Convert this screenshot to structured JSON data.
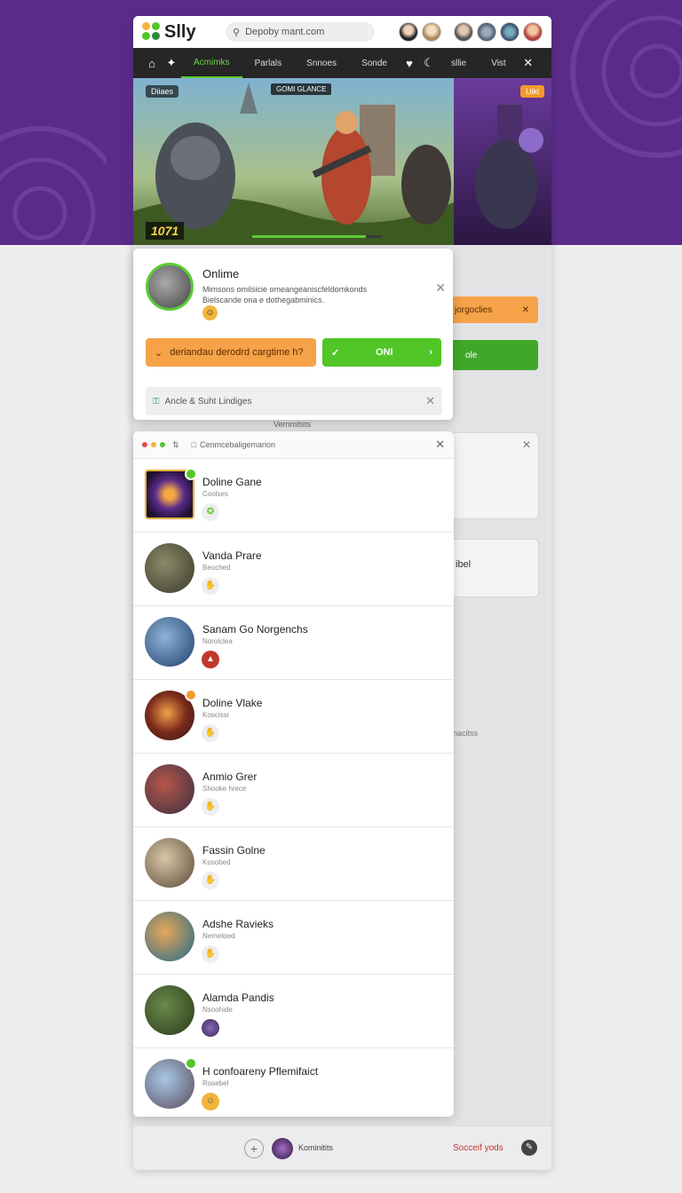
{
  "app": {
    "name": "Slly"
  },
  "search": {
    "placeholder": "Depoby mant.com"
  },
  "nav": {
    "tabs": [
      "Acmimks",
      "Parlals",
      "Snnoes",
      "Sonde"
    ],
    "active_tab": 0,
    "right_tabs": [
      "sllie",
      "Vist"
    ]
  },
  "hero": {
    "top_label": "Diiaes",
    "chip_label": "GOMI GLANCE",
    "score": "1071",
    "badge": "Uiki",
    "progress": 0.88
  },
  "popup": {
    "title": "Onlime",
    "description": "Mimsons omilsicie omeangeaniscfeldomkonds Bielscande ona e dothegabminics.",
    "button_orange": "deriandau derodrd cargtime h?",
    "button_green": "ONI",
    "field_label": "Ancle & Suht Lindiges"
  },
  "side": {
    "orange_label": "jorgoclies",
    "green_label": "ole",
    "strip_label": "Vernmitsts",
    "card_label": "ibel",
    "faint_label": "nacitss"
  },
  "list": {
    "header": "Cenmcebaligemarion",
    "items": [
      {
        "name": "Doline Gane",
        "sub": "Coolses",
        "icon": "sparkle-icon",
        "status": "green"
      },
      {
        "name": "Vanda Prare",
        "sub": "Beoched",
        "icon": "hand-icon",
        "status": ""
      },
      {
        "name": "Sanam Go Norgenchs",
        "sub": "Norolclea",
        "icon": "flame-icon",
        "status": ""
      },
      {
        "name": "Doline Vlake",
        "sub": "Koscissr",
        "icon": "hand-icon",
        "status": "orange"
      },
      {
        "name": "Anmio Grer",
        "sub": "Shooke hrece",
        "icon": "hand-icon",
        "status": ""
      },
      {
        "name": "Fassin Golne",
        "sub": "Kosobed",
        "icon": "hand-icon",
        "status": ""
      },
      {
        "name": "Adshe Ravieks",
        "sub": "Nemeloed",
        "icon": "hand-icon",
        "status": ""
      },
      {
        "name": "Alamda Pandis",
        "sub": "Nsoohide",
        "icon": "avatar-icon",
        "status": ""
      },
      {
        "name": "H confoareny Pflemifaict",
        "sub": "Rosebel",
        "icon": "smile-icon",
        "status": "green"
      }
    ]
  },
  "bottom": {
    "label": "Kominitits",
    "red_label": "Socceif yods"
  },
  "colors": {
    "purple": "#5b2b8a",
    "green": "#52c626",
    "orange": "#f6a248",
    "nav_dark": "#262626"
  }
}
